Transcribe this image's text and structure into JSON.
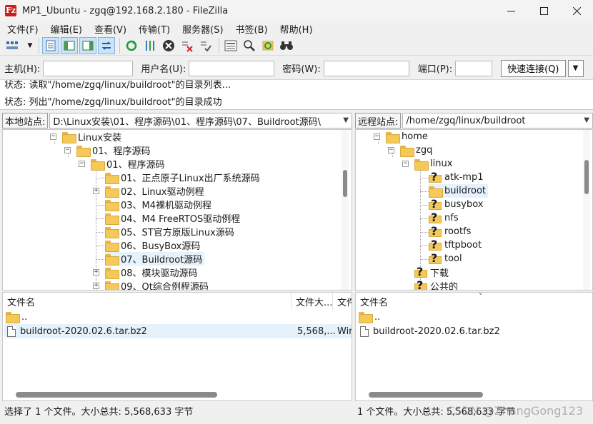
{
  "window": {
    "title": "MP1_Ubuntu - zgq@192.168.2.180 - FileZilla",
    "app_icon_letter": "Fz"
  },
  "menu": [
    "文件(F)",
    "编辑(E)",
    "查看(V)",
    "传输(T)",
    "服务器(S)",
    "书签(B)",
    "帮助(H)"
  ],
  "quickconnect": {
    "host_label": "主机(H):",
    "user_label": "用户名(U):",
    "pass_label": "密码(W):",
    "port_label": "端口(P):",
    "host_value": "",
    "user_value": "",
    "pass_value": "",
    "port_value": "",
    "connect_button": "快速连接(Q)"
  },
  "log": [
    "状态: 读取\"/home/zgq/linux/buildroot\"的目录列表...",
    "状态: 列出\"/home/zgq/linux/buildroot\"的目录成功"
  ],
  "local": {
    "site_label": "本地站点:",
    "path": "D:\\Linux安装\\01、程序源码\\01、程序源码\\07、Buildroot源码\\",
    "tree": [
      {
        "label": "Linux安装",
        "expander": "−"
      },
      {
        "label": "01、程序源码",
        "expander": "−"
      },
      {
        "label": "01、程序源码",
        "expander": "−"
      },
      {
        "label": "01、正点原子Linux出厂系统源码",
        "expander": ""
      },
      {
        "label": "02、Linux驱动例程",
        "expander": "+"
      },
      {
        "label": "03、M4裸机驱动例程",
        "expander": ""
      },
      {
        "label": "04、M4 FreeRTOS驱动例程",
        "expander": ""
      },
      {
        "label": "05、ST官方原版Linux源码",
        "expander": ""
      },
      {
        "label": "06、BusyBox源码",
        "expander": ""
      },
      {
        "label": "07、Buildroot源码",
        "expander": ""
      },
      {
        "label": "08、模块驱动源码",
        "expander": "+"
      },
      {
        "label": "09、Qt综合例程源码",
        "expander": "+"
      }
    ],
    "columns": [
      "文件名",
      "文件大...",
      "文件"
    ],
    "files": [
      {
        "name": "..",
        "size": "",
        "type": "",
        "kind": "folder"
      },
      {
        "name": "buildroot-2020.02.6.tar.bz2",
        "size": "5,568,...",
        "type": "Wir",
        "kind": "file"
      }
    ],
    "status": "选择了 1 个文件。大小总共: 5,568,633 字节"
  },
  "remote": {
    "site_label": "远程站点:",
    "path": "/home/zgq/linux/buildroot",
    "tree": [
      {
        "label": "home",
        "expander": "−",
        "unknown": false
      },
      {
        "label": "zgq",
        "expander": "−",
        "unknown": false
      },
      {
        "label": "linux",
        "expander": "−",
        "unknown": false
      },
      {
        "label": "atk-mp1",
        "expander": "",
        "unknown": true
      },
      {
        "label": "buildroot",
        "expander": "",
        "unknown": false
      },
      {
        "label": "busybox",
        "expander": "",
        "unknown": true
      },
      {
        "label": "nfs",
        "expander": "",
        "unknown": true
      },
      {
        "label": "rootfs",
        "expander": "",
        "unknown": true
      },
      {
        "label": "tftpboot",
        "expander": "",
        "unknown": true
      },
      {
        "label": "tool",
        "expander": "",
        "unknown": true
      },
      {
        "label": "下载",
        "expander": "",
        "unknown": true
      },
      {
        "label": "公共的",
        "expander": "",
        "unknown": true
      }
    ],
    "columns": [
      "文件名"
    ],
    "files": [
      {
        "name": "..",
        "kind": "folder"
      },
      {
        "name": "buildroot-2020.02.6.tar.bz2",
        "kind": "file"
      }
    ],
    "status": "1 个文件。大小总共: 5,568,633 字节"
  },
  "watermark": "CSDN @ZhangGong123",
  "colors": {
    "accent": "#0078d4",
    "folder": "#f5c85a",
    "selected_row": "#e5f1fb"
  }
}
